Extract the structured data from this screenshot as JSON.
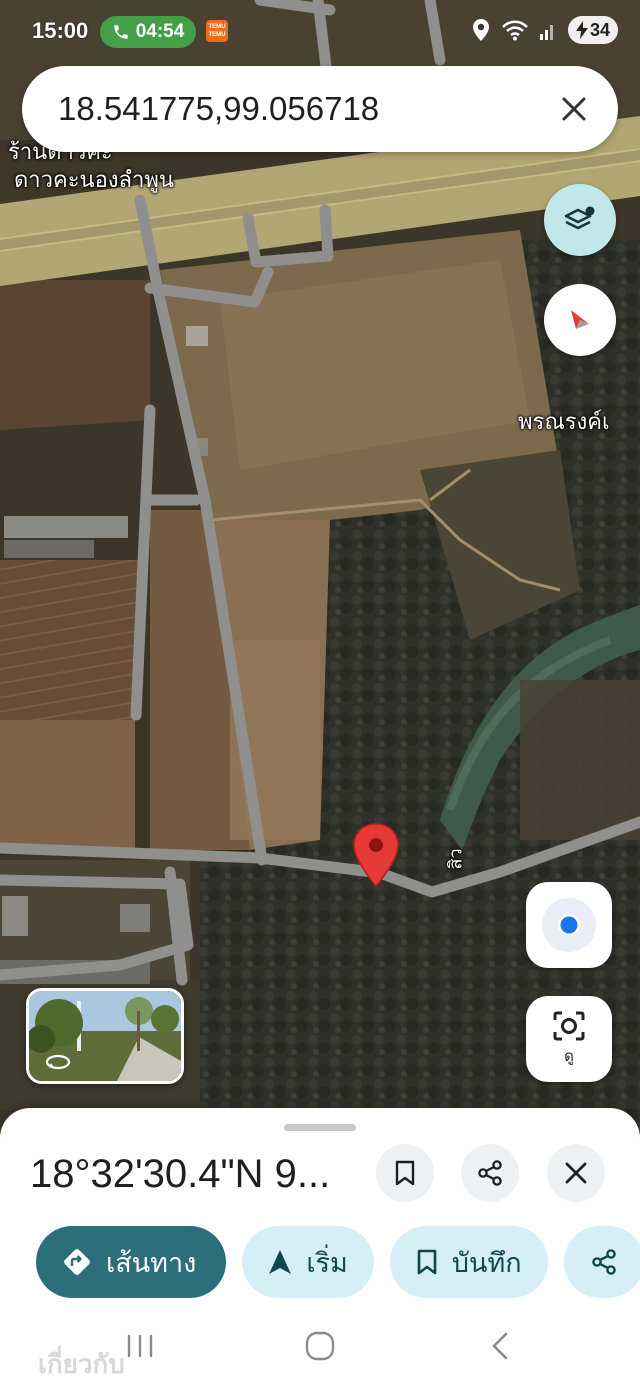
{
  "status_bar": {
    "time": "15:00",
    "call_timer": "04:54",
    "temu_badge_line1": "TEMU",
    "temu_badge_line2": "TEMU",
    "battery": "34"
  },
  "search": {
    "query": "18.541775,99.056718"
  },
  "map": {
    "labels": {
      "shop_line1": "ร้านดาวคะ",
      "shop_line2": "ดาวคะนองลำพูน",
      "place_right": "พรณรงค์เ",
      "road_label": "สิว"
    }
  },
  "buttons": {
    "lens_label": "ดู"
  },
  "place": {
    "title": "18°32'30.4\"N 9..."
  },
  "actions": [
    {
      "label": "เส้นทาง",
      "icon": "directions-icon"
    },
    {
      "label": "เริ่ม",
      "icon": "navigation-arrow-icon"
    },
    {
      "label": "บันทึก",
      "icon": "bookmark-icon"
    },
    {
      "label": "",
      "icon": "share-icon"
    }
  ],
  "related_label": "เกี่ยวกับ",
  "colors": {
    "pin": "#e53935",
    "primary_chip": "#2c6e7a",
    "secondary_chip": "#d6eff7",
    "layers_button": "#c2e7ea",
    "call_pill": "#43a047",
    "location_dot": "#1a73e8"
  }
}
